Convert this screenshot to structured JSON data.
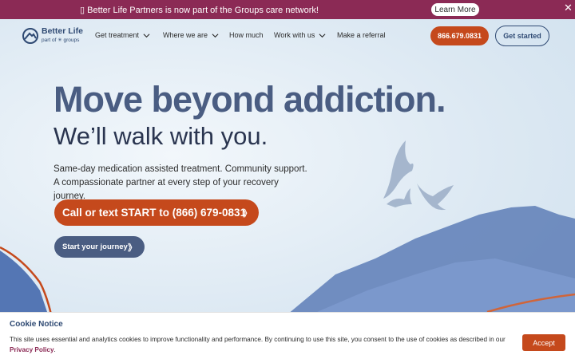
{
  "announcement": {
    "text": "Better Life Partners is now part of the Groups care network!",
    "button_label": "Learn More",
    "close_icon": "close-icon"
  },
  "logo": {
    "name": "Better Life",
    "sub": "part of ✳ groups"
  },
  "nav": {
    "items": [
      {
        "label": "Get treatment",
        "has_dropdown": true
      },
      {
        "label": "Where we are",
        "has_dropdown": true
      },
      {
        "label": "How much",
        "has_dropdown": false
      },
      {
        "label": "Work with us",
        "has_dropdown": true
      },
      {
        "label": "Make a referral",
        "has_dropdown": false
      }
    ],
    "phone_button": "866.679.0831",
    "start_button": "Get started"
  },
  "hero": {
    "headline": "Move beyond addiction.",
    "subheadline": "We’ll walk with you.",
    "description": "Same-day medication assisted treatment. Community support. A compassionate partner at every step of your recovery journey.",
    "cta_call": "Call or text START to (866) 679-0831",
    "cta_journey": "Start your journey",
    "arrow_glyph": "》"
  },
  "cookie": {
    "title": "Cookie Notice",
    "text": "This site uses essential and analytics cookies to improve functionality and performance. By continuing to use this site, you consent to the use of cookies as described in our ",
    "link_text": "Privacy Policy",
    "suffix": ".",
    "accept_label": "Accept"
  },
  "colors": {
    "brand_plum": "#8b2a55",
    "brand_orange": "#c5491c",
    "brand_navy": "#2f4a73",
    "slate_blue": "#4a5d82"
  }
}
